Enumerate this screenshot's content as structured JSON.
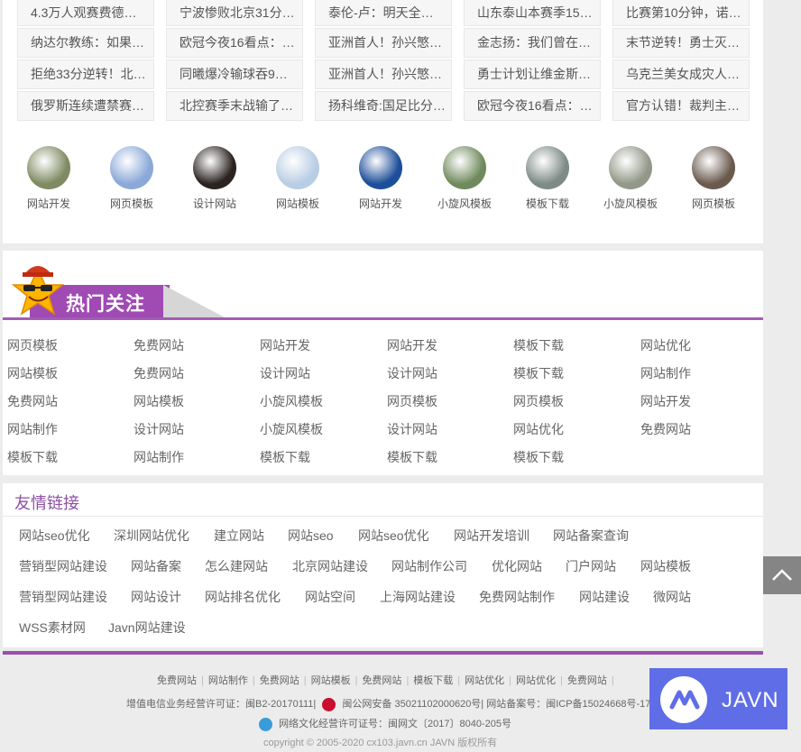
{
  "news": {
    "columns": [
      [
        "4.3万人观赛费德…",
        "纳达尔教练：如果…",
        "拒绝33分逆转！北…",
        "俄罗斯连续遭禁赛…"
      ],
      [
        "宁波惨败北京31分…",
        "欧冠今夜16看点：…",
        "同曦爆冷输球吞9…",
        "北控赛季末战输了…"
      ],
      [
        "泰伦-卢：明天全…",
        "亚洲首人！孙兴慜…",
        "亚洲首人！孙兴慜…",
        "扬科维奇:国足比分…"
      ],
      [
        "山东泰山本赛季15…",
        "金志扬：我们曾在…",
        "勇士计划让维金斯…",
        "欧冠今夜16看点：…"
      ],
      [
        "比赛第10分钟，诺…",
        "末节逆转！勇士灭…",
        "乌克兰美女成灾人…",
        "官方认错！裁判主…"
      ]
    ]
  },
  "thumbs": [
    {
      "caption": "网站开发",
      "color": "#7f8a62"
    },
    {
      "caption": "网页模板",
      "color": "#8aa8d8"
    },
    {
      "caption": "设计网站",
      "color": "#2a2320"
    },
    {
      "caption": "网站模板",
      "color": "#b9cde4"
    },
    {
      "caption": "网站开发",
      "color": "#1d4e9a"
    },
    {
      "caption": "小旋风模板",
      "color": "#6f8a5c"
    },
    {
      "caption": "模板下载",
      "color": "#7d8a86"
    },
    {
      "caption": "小旋风模板",
      "color": "#929888"
    },
    {
      "caption": "网页模板",
      "color": "#6a5a4e"
    }
  ],
  "hot": {
    "title": "热门关注",
    "items": [
      [
        "网页模板",
        "免费网站",
        "网站开发",
        "网站开发",
        "模板下载",
        "网站优化"
      ],
      [
        "网站模板",
        "免费网站",
        "设计网站",
        "设计网站",
        "模板下载",
        "网站制作"
      ],
      [
        "免费网站",
        "网站模板",
        "小旋风模板",
        "网页模板",
        "网页模板",
        "网站开发"
      ],
      [
        "网站制作",
        "设计网站",
        "小旋风模板",
        "设计网站",
        "网站优化",
        "免费网站"
      ],
      [
        "模板下载",
        "网站制作",
        "模板下载",
        "模板下载",
        "模板下载"
      ]
    ]
  },
  "links": {
    "title": "友情链接",
    "rows": [
      [
        "网站seo优化",
        "深圳网站优化",
        "建立网站",
        "网站seo",
        "网站seo优化",
        "网站开发培训",
        "网站备案查询"
      ],
      [
        "营销型网站建设",
        "网站备案",
        "怎么建网站",
        "北京网站建设",
        "网站制作公司",
        "优化网站",
        "门户网站",
        "网站模板"
      ],
      [
        "营销型网站建设",
        "网站设计",
        "网站排名优化",
        "网站空间",
        "上海网站建设",
        "免费网站制作",
        "网站建设",
        "微网站"
      ],
      [
        "WSS素材网",
        "Javn网站建设"
      ]
    ]
  },
  "footer": {
    "links": [
      "免费网站",
      "网站制作",
      "免费网站",
      "网站模板",
      "免费网站",
      "模板下载",
      "网站优化",
      "网站优化",
      "免费网站"
    ],
    "license": "增值电信业务经营许可证：闽B2-20170111|",
    "police": "闽公网安备 35021102000620号| 网站备案号：闽ICP备15024668号-17",
    "culture": "网络文化经营许可证号：闽网文〔2017〕8040-205号",
    "copyright": "copyright © 2005-2020 cx103.javn.cn JAVN 版权所有",
    "extra": "…………………………………………"
  },
  "javn": {
    "brand": "JAVN"
  }
}
